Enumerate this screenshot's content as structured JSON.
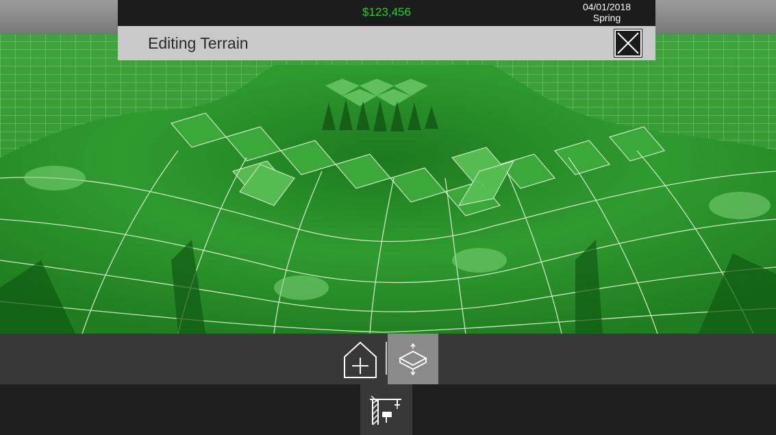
{
  "status_bar": {
    "money": "$123,456",
    "date": "04/01/2018",
    "season": "Spring",
    "money_color": "#1ed41e"
  },
  "edit_panel": {
    "title": "Editing Terrain",
    "close_icon": "close-x-icon"
  },
  "toolbar": {
    "tools": [
      {
        "name": "add-building",
        "icon": "house-plus-icon",
        "selected": false
      },
      {
        "name": "terrain-edit",
        "icon": "terrain-raise-lower-icon",
        "selected": true
      }
    ]
  },
  "build_bar": {
    "tools": [
      {
        "name": "construction",
        "icon": "crane-icon",
        "selected": true
      }
    ]
  },
  "colors": {
    "terrain": "#2d8a2a",
    "terrain_light": "#5cc25a",
    "panel": "#c9c9c9",
    "toolbar": "#383838",
    "selected_tool": "#8a8a8a"
  }
}
